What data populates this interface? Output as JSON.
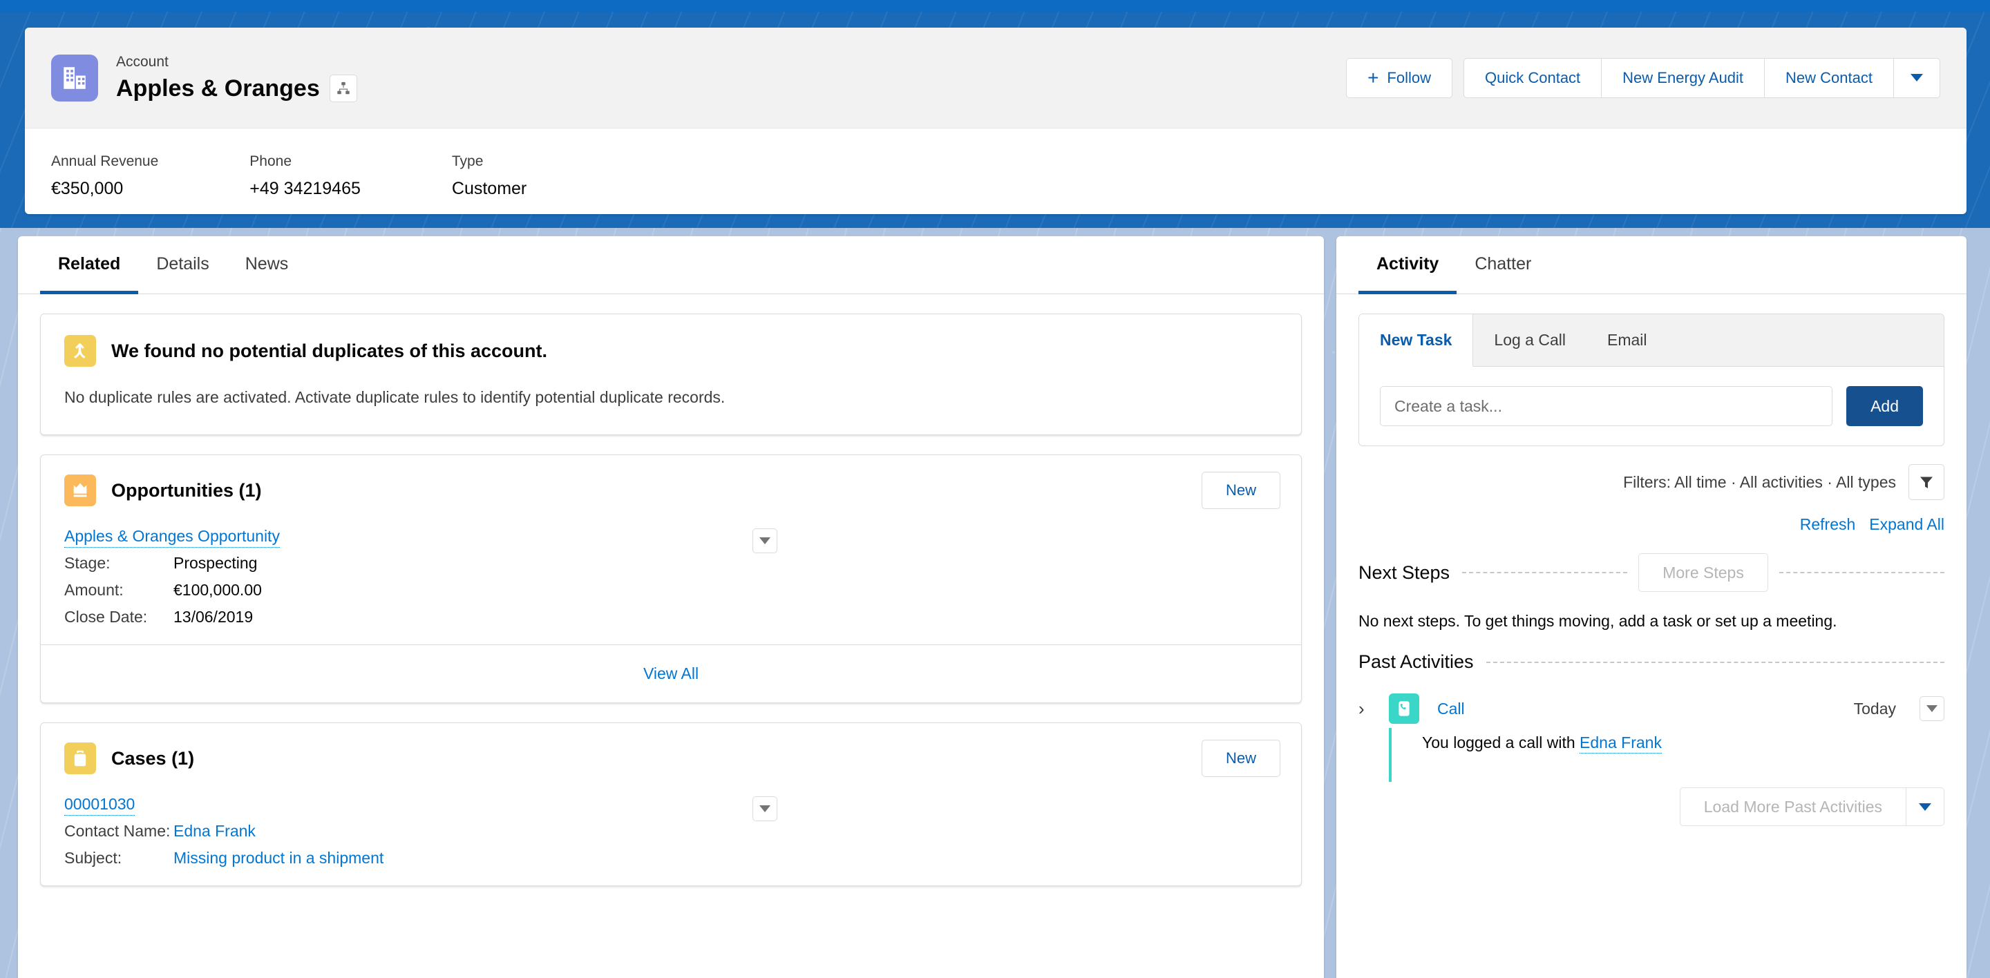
{
  "record": {
    "object_label": "Account",
    "name": "Apples & Oranges",
    "avatar_icon": "account-building-icon",
    "hierarchy_icon": "hierarchy-icon",
    "actions": {
      "follow": "Follow",
      "quick_contact": "Quick Contact",
      "new_energy_audit": "New Energy Audit",
      "new_contact": "New Contact",
      "more_icon": "chevron-down-icon"
    },
    "fields": [
      {
        "label": "Annual Revenue",
        "value": "€350,000"
      },
      {
        "label": "Phone",
        "value": "+49 34219465"
      },
      {
        "label": "Type",
        "value": "Customer"
      }
    ]
  },
  "left": {
    "tabs": [
      {
        "label": "Related",
        "active": true
      },
      {
        "label": "Details",
        "active": false
      },
      {
        "label": "News",
        "active": false
      }
    ],
    "duplicates": {
      "icon": "merge-arrow-icon",
      "title": "We found no potential duplicates of this account.",
      "body": "No duplicate rules are activated. Activate duplicate rules to identify potential duplicate records."
    },
    "opportunities": {
      "icon": "crown-icon",
      "title": "Opportunities (1)",
      "new_label": "New",
      "row_menu_icon": "chevron-down-icon",
      "record_link": "Apples & Oranges Opportunity",
      "fields": [
        {
          "key": "Stage:",
          "value": "Prospecting",
          "link": false
        },
        {
          "key": "Amount:",
          "value": "€100,000.00",
          "link": false
        },
        {
          "key": "Close Date:",
          "value": "13/06/2019",
          "link": false
        }
      ],
      "view_all": "View All"
    },
    "cases": {
      "icon": "briefcase-icon",
      "title": "Cases (1)",
      "new_label": "New",
      "row_menu_icon": "chevron-down-icon",
      "record_link": "00001030",
      "fields": [
        {
          "key": "Contact Name:",
          "value": "Edna Frank",
          "link": true
        },
        {
          "key": "Subject:",
          "value": "Missing product in a shipment",
          "link": true
        }
      ]
    }
  },
  "right": {
    "tabs": [
      {
        "label": "Activity",
        "active": true
      },
      {
        "label": "Chatter",
        "active": false
      }
    ],
    "composer": {
      "tabs": [
        {
          "label": "New Task",
          "active": true
        },
        {
          "label": "Log a Call",
          "active": false
        },
        {
          "label": "Email",
          "active": false
        }
      ],
      "input_placeholder": "Create a task...",
      "input_value": "",
      "add_label": "Add"
    },
    "filters": {
      "text": "Filters: All time · All activities · All types",
      "icon": "filter-icon"
    },
    "links": {
      "refresh": "Refresh",
      "expand_all": "Expand All"
    },
    "next_steps": {
      "title": "Next Steps",
      "more_button": "More Steps",
      "empty_text": "No next steps. To get things moving, add a task or set up a meeting."
    },
    "past_activities": {
      "title": "Past Activities",
      "items": [
        {
          "expand_icon": "chevron-right-icon",
          "type_icon": "phone-log-call-icon",
          "title": "Call",
          "date": "Today",
          "menu_icon": "chevron-down-icon",
          "detail_prefix": "You logged a call with ",
          "detail_link": "Edna Frank"
        }
      ],
      "load_more": "Load More Past Activities",
      "load_more_menu_icon": "chevron-down-icon"
    }
  },
  "colors": {
    "brand_blue": "#0b5cab",
    "link_blue": "#0176d3",
    "page_bg": "#aec3e0",
    "header_bg": "#1b6ab7",
    "accent_yellow": "#f2cf5b",
    "accent_orange": "#fcb95b",
    "accent_teal": "#3ad6c7",
    "avatar_purple": "#7f8ce0",
    "add_button": "#17508e"
  }
}
